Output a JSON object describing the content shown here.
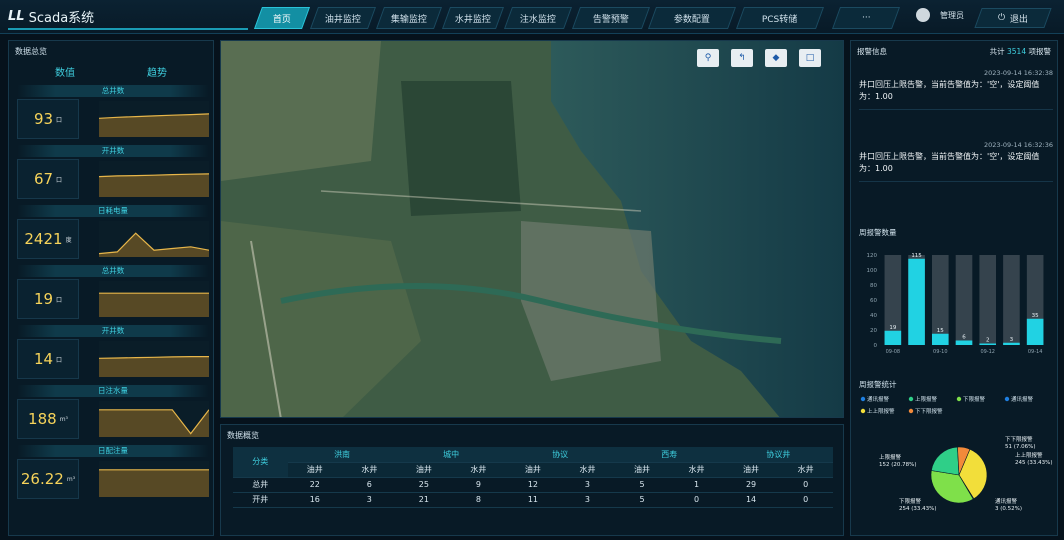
{
  "app": {
    "title": "Scada系统"
  },
  "nav": [
    {
      "label": "首页",
      "active": true
    },
    {
      "label": "油井监控"
    },
    {
      "label": "集输监控"
    },
    {
      "label": "水井监控"
    },
    {
      "label": "注水监控"
    },
    {
      "label": "告警预警"
    },
    {
      "label": "参数配置"
    },
    {
      "label": "PCS转储"
    },
    {
      "label": "···"
    }
  ],
  "user": {
    "name": "管理员"
  },
  "exit_label": "退出",
  "overview": {
    "title": "数据总览",
    "col_value": "数值",
    "col_trend": "趋势",
    "metrics": [
      {
        "label": "总井数",
        "value": "93",
        "unit": "口",
        "trend": [
          0.55,
          0.58,
          0.6,
          0.62,
          0.64,
          0.66,
          0.68
        ]
      },
      {
        "label": "开井数",
        "value": "67",
        "unit": "口",
        "trend": [
          0.6,
          0.62,
          0.63,
          0.64,
          0.66,
          0.67,
          0.68
        ]
      },
      {
        "label": "日耗电量",
        "value": "2421",
        "unit": "度",
        "trend": [
          0.1,
          0.15,
          0.7,
          0.2,
          0.25,
          0.3,
          0.2
        ]
      },
      {
        "label": "总井数",
        "value": "19",
        "unit": "口",
        "trend": [
          0.7,
          0.7,
          0.7,
          0.7,
          0.7,
          0.7,
          0.7
        ]
      },
      {
        "label": "开井数",
        "value": "14",
        "unit": "口",
        "trend": [
          0.55,
          0.56,
          0.57,
          0.58,
          0.59,
          0.6,
          0.6
        ]
      },
      {
        "label": "日注水量",
        "value": "188",
        "unit": "m³",
        "trend": [
          0.8,
          0.8,
          0.8,
          0.8,
          0.8,
          0.1,
          0.8
        ]
      },
      {
        "label": "日配注量",
        "value": "26.22",
        "unit": "m³",
        "trend": [
          0.8,
          0.8,
          0.8,
          0.8,
          0.8,
          0.8,
          0.8
        ]
      }
    ]
  },
  "map": {
    "controls": [
      {
        "icon": "location-icon",
        "glyph": "⚲"
      },
      {
        "icon": "route-icon",
        "glyph": "↰"
      },
      {
        "icon": "layers-icon",
        "glyph": "◆"
      },
      {
        "icon": "square-icon",
        "glyph": "□"
      }
    ]
  },
  "data_summary": {
    "title": "数据概览",
    "category_label": "分类",
    "groups": [
      "洪南",
      "城中",
      "协议",
      "西寿",
      "协议井"
    ],
    "sub_headers": [
      "油井",
      "水井"
    ],
    "rows": [
      {
        "label": "总井",
        "values": [
          "22",
          "6",
          "25",
          "9",
          "12",
          "3",
          "5",
          "1",
          "29",
          "0"
        ]
      },
      {
        "label": "开井",
        "values": [
          "16",
          "3",
          "21",
          "8",
          "11",
          "3",
          "5",
          "0",
          "14",
          "0"
        ]
      }
    ]
  },
  "alarms": {
    "title": "报警信息",
    "total_label": "共计",
    "total": "3514",
    "total_unit": "项报警",
    "items": [
      {
        "time": "2023-09-14 16:32:38",
        "message": "井口回压上限告警，当前告警值为：'空'，设定阈值为：1.00"
      },
      {
        "time": "2023-09-14 16:32:36",
        "message": "井口回压上限告警，当前告警值为：'空'，设定阈值为：1.00"
      }
    ]
  },
  "weekly_chart": {
    "title": "周报警数量",
    "chart_data": {
      "type": "bar",
      "categories": [
        "09-08",
        "09-09",
        "09-10",
        "09-11",
        "09-12",
        "09-13",
        "09-14"
      ],
      "tick_labels": [
        "09-08",
        "",
        "09-10",
        "",
        "09-12",
        "",
        "09-14"
      ],
      "values": [
        19,
        115,
        15,
        6,
        2,
        3,
        35
      ],
      "ylim": [
        0,
        120
      ],
      "yticks": [
        "0",
        "20",
        "40",
        "60",
        "80",
        "100",
        "120"
      ],
      "bar_color": "#21d2e3",
      "track_color": "#35434d"
    }
  },
  "weekly_stats": {
    "title": "周报警统计",
    "chart_data": {
      "type": "pie",
      "slices": [
        {
          "name": "上上限报警",
          "value": 245,
          "percent": "33.43%",
          "color": "#f2de3a"
        },
        {
          "name": "通讯报警",
          "value": 3,
          "percent": "0.52%",
          "color": "#1e7fe0"
        },
        {
          "name": "下限报警",
          "value": 254,
          "percent": "33.43%",
          "color": "#7fe04a"
        },
        {
          "name": "上限报警",
          "value": 152,
          "percent": "20.78%",
          "color": "#2fcf88"
        },
        {
          "name": "下下限报警",
          "value": 51,
          "percent": "7.06%",
          "color": "#f28a3a"
        }
      ],
      "legend": [
        {
          "name": "通讯报警",
          "color": "#1e7fe0"
        },
        {
          "name": "上限报警",
          "color": "#2fcf88"
        },
        {
          "name": "下限报警",
          "color": "#7fe04a"
        },
        {
          "name": "通讯报警",
          "color": "#1e7fe0"
        },
        {
          "name": "上上限报警",
          "color": "#f2de3a"
        },
        {
          "name": "下下限报警",
          "color": "#f28a3a"
        }
      ]
    }
  }
}
